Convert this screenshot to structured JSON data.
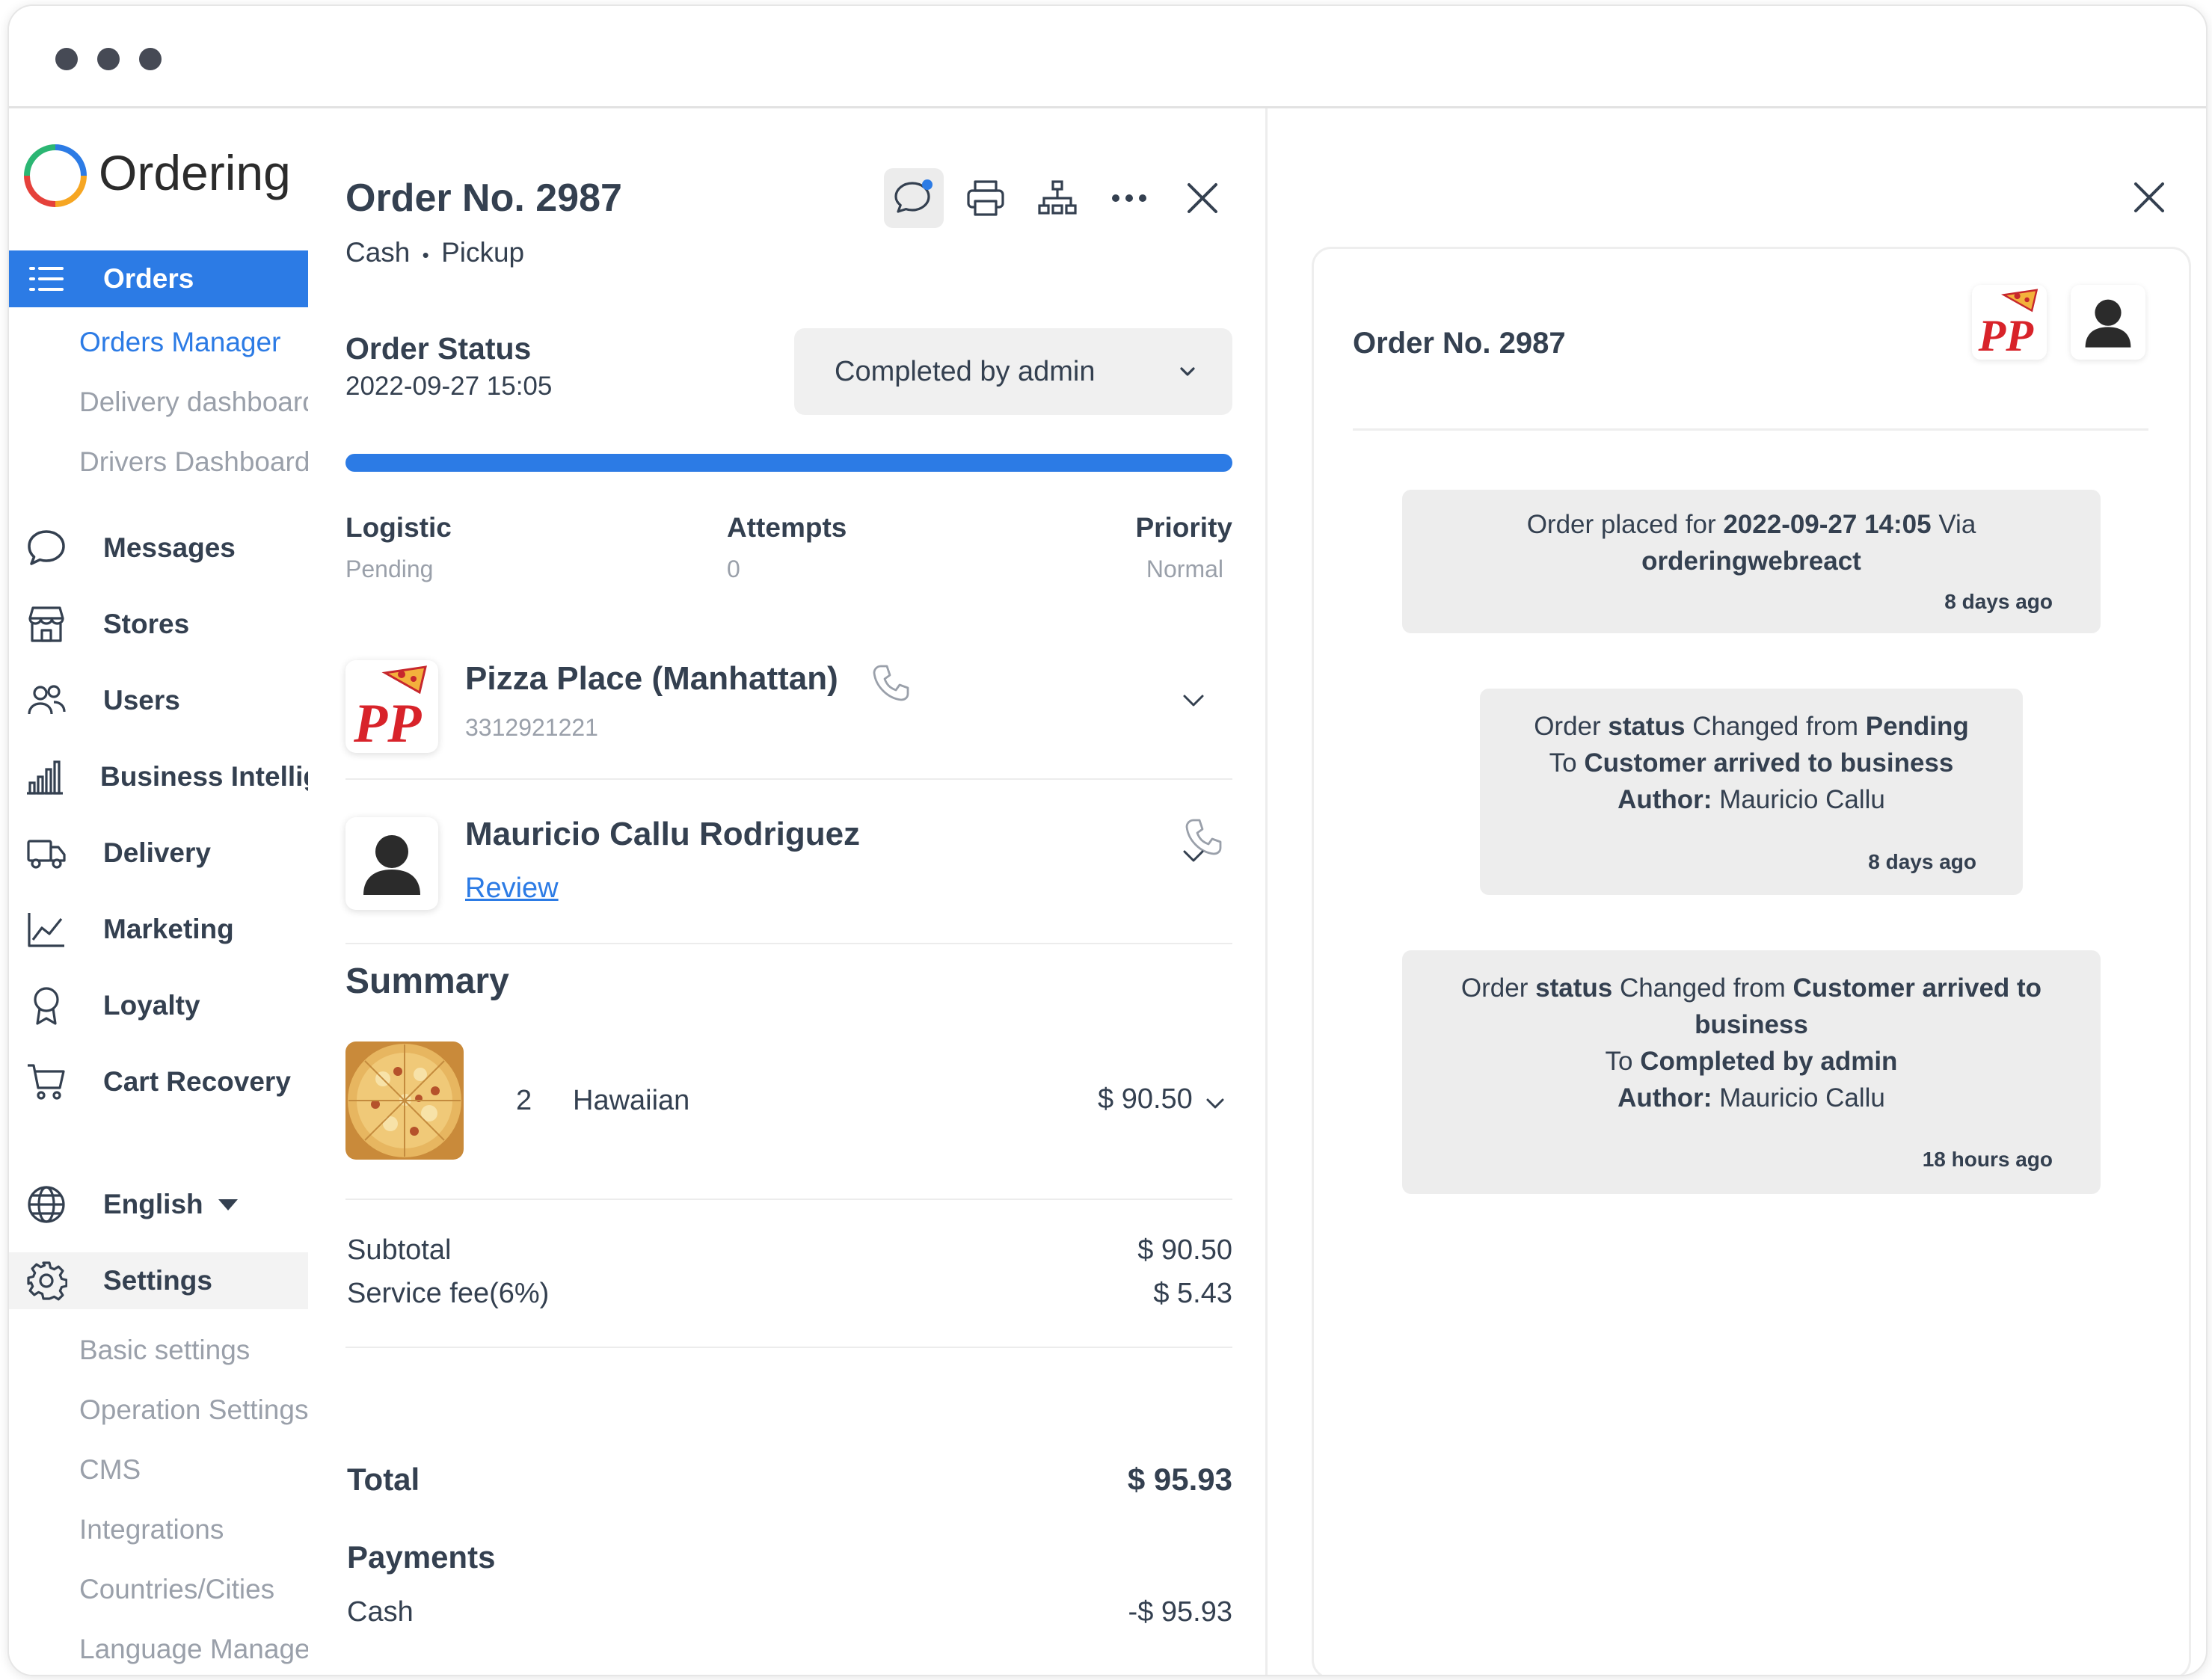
{
  "app": {
    "name": "Ordering"
  },
  "sidebar": {
    "orders": "Orders",
    "orders_sub": [
      "Orders Manager",
      "Delivery dashboard",
      "Drivers Dashboard"
    ],
    "items": [
      "Messages",
      "Stores",
      "Users",
      "Business Intelligence",
      "Delivery",
      "Marketing",
      "Loyalty",
      "Cart Recovery"
    ],
    "language": "English",
    "settings": "Settings",
    "settings_sub": [
      "Basic settings",
      "Operation Settings",
      "CMS",
      "Integrations",
      "Countries/Cities",
      "Language Manager"
    ]
  },
  "order": {
    "title": "Order No. 2987",
    "payment": "Cash",
    "separator": "•",
    "delivery_type": "Pickup",
    "status_label": "Order Status",
    "status_date": "2022-09-27 15:05",
    "status_value": "Completed by admin",
    "progress_percent": 100,
    "meta": {
      "logistic_label": "Logistic",
      "logistic_value": "Pending",
      "attempts_label": "Attempts",
      "attempts_value": "0",
      "priority_label": "Priority",
      "priority_value": "Normal"
    },
    "business": {
      "name": "Pizza Place (Manhattan)",
      "phone": "3312921221",
      "logo_text": "PP"
    },
    "customer": {
      "name": "Mauricio Callu Rodriguez",
      "review": "Review"
    },
    "summary_title": "Summary",
    "products": [
      {
        "qty": "2",
        "name": "Hawaiian",
        "price": "$ 90.50"
      }
    ],
    "subtotal_label": "Subtotal",
    "subtotal": "$ 90.50",
    "service_fee_label": "Service fee(6%)",
    "service_fee": "$ 5.43",
    "total_label": "Total",
    "total": "$ 95.93",
    "payments_title": "Payments",
    "payments": [
      {
        "method": "Cash",
        "amount": "-$ 95.93"
      }
    ]
  },
  "history": {
    "title": "Order No. 2987",
    "events": [
      {
        "p1": "Order placed for ",
        "date": "2022-09-27 14:05",
        "p2": " Via",
        "source": "orderingwebreact",
        "ago": "8 days ago"
      },
      {
        "p1": "Order ",
        "w_status": "status",
        "p2": " Changed from ",
        "from": "Pending",
        "to_label": "To ",
        "to": "Customer arrived to business",
        "author_label": "Author:",
        "author": " Mauricio Callu",
        "ago": "8 days ago"
      },
      {
        "p1": "Order ",
        "w_status": "status",
        "p2": " Changed from ",
        "from1": "Customer arrived to",
        "from2": "business",
        "to_label": "To ",
        "to": "Completed by admin",
        "author_label": "Author:",
        "author": " Mauricio Callu",
        "ago": "18 hours ago"
      }
    ]
  },
  "colors": {
    "accent": "#2c7be5",
    "text": "#344050",
    "muted": "#9aa0aa",
    "pp_red": "#d8232a"
  }
}
